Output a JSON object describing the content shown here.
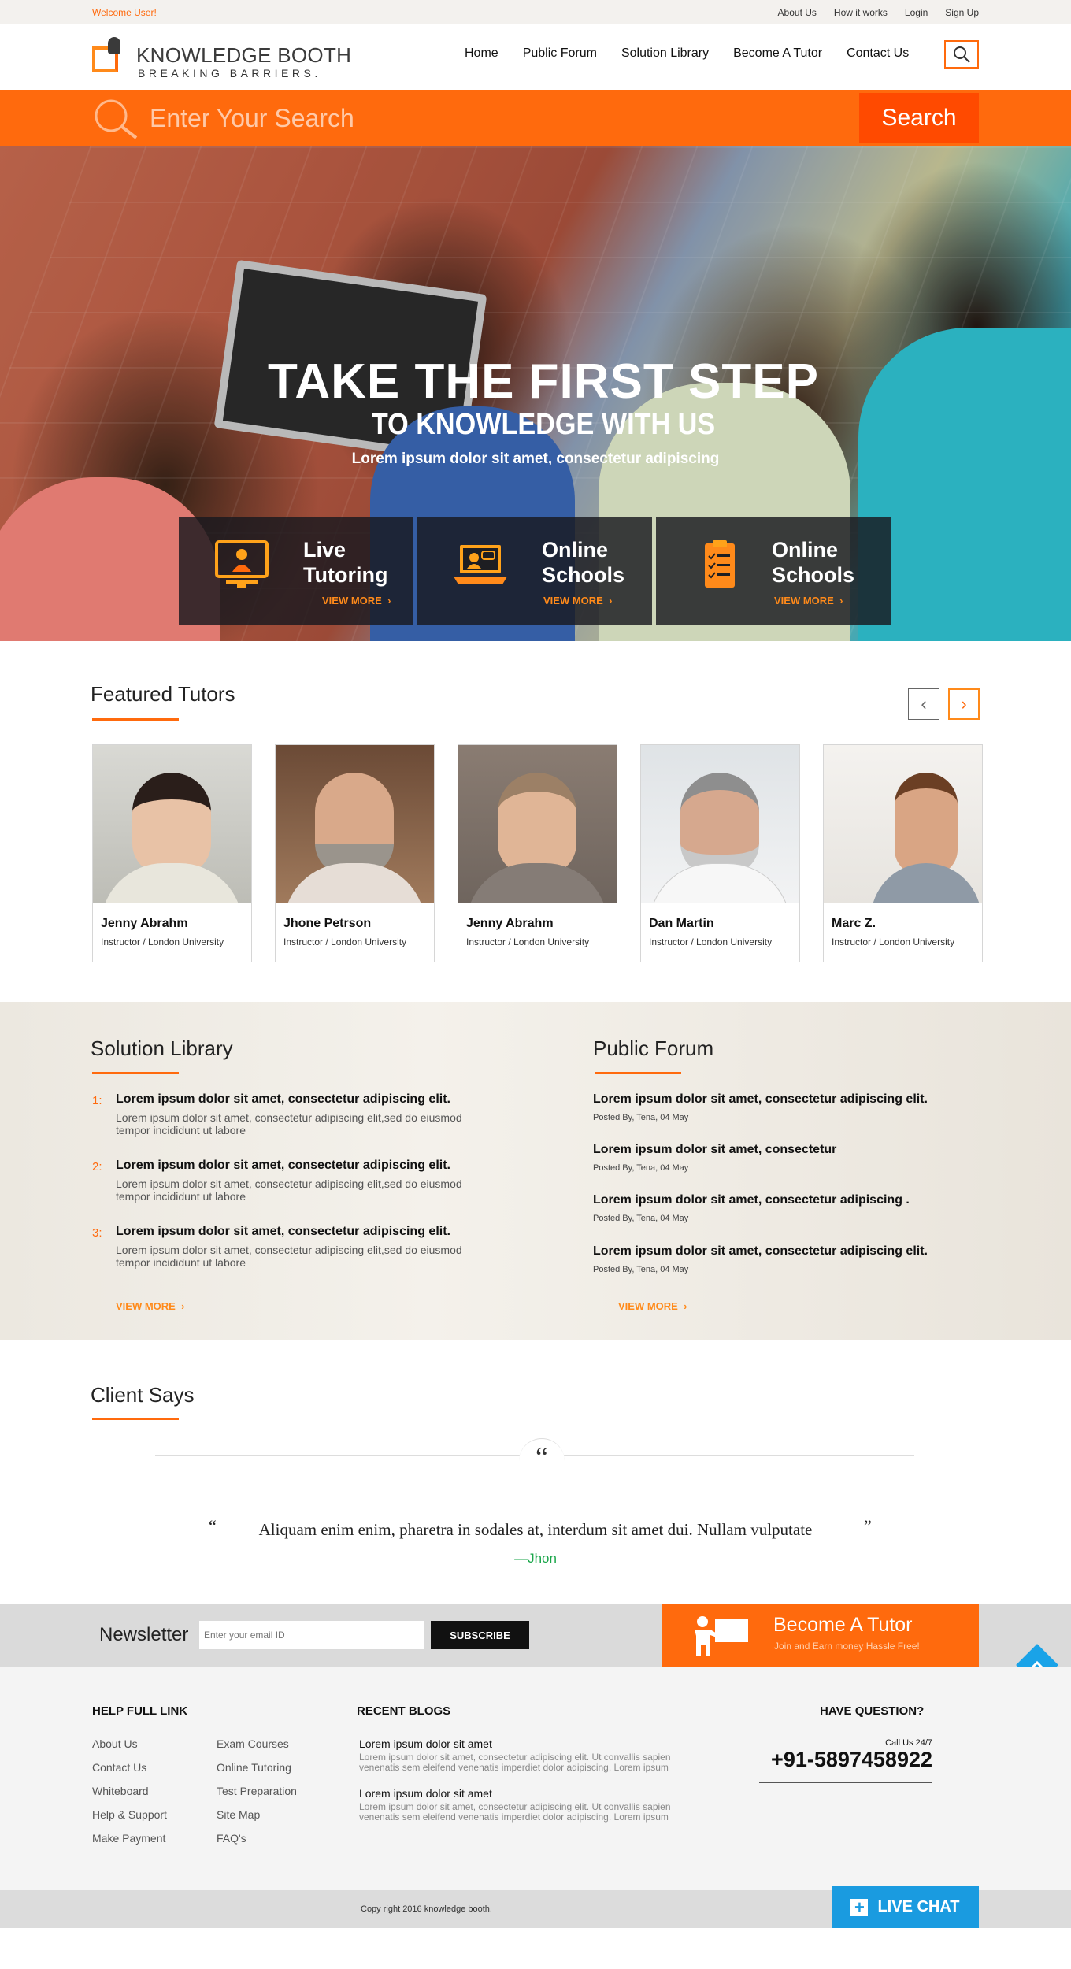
{
  "topbar": {
    "welcome": "Welcome User!",
    "links": [
      "About Us",
      "How it works",
      "Login",
      "Sign Up"
    ]
  },
  "header": {
    "logo_title": "KNOWLEDGE BOOTH",
    "logo_tagline": "BREAKING BARRIERS.",
    "nav": [
      "Home",
      "Public Forum",
      "Solution Library",
      "Become A Tutor",
      "Contact Us"
    ],
    "search_icon": "search-icon"
  },
  "search": {
    "placeholder": "Enter Your Search",
    "button": "Search"
  },
  "hero": {
    "title": "TAKE THE FIRST STEP",
    "subtitle": "TO KNOWLEDGE WITH US",
    "tagline": "Lorem ipsum dolor sit amet, consectetur adipiscing",
    "features": [
      {
        "line1": "Live",
        "line2": "Tutoring",
        "more": "VIEW MORE",
        "icon": "tutor-monitor-icon"
      },
      {
        "line1": "Online",
        "line2": "Schools",
        "more": "VIEW MORE",
        "icon": "laptop-chat-icon"
      },
      {
        "line1": "Online",
        "line2": "Schools",
        "more": "VIEW MORE",
        "icon": "clipboard-checklist-icon"
      }
    ]
  },
  "featured_tutors": {
    "title": "Featured Tutors",
    "tutors": [
      {
        "name": "Jenny Abrahm",
        "role": "Instructor / London University"
      },
      {
        "name": "Jhone Petrson",
        "role": "Instructor / London University"
      },
      {
        "name": "Jenny Abrahm",
        "role": "Instructor / London University"
      },
      {
        "name": "Dan Martin",
        "role": "Instructor / London University"
      },
      {
        "name": "Marc Z.",
        "role": "Instructor / London University"
      }
    ]
  },
  "solution_library": {
    "title": "Solution Library",
    "items": [
      {
        "num": "1:",
        "head": "Lorem ipsum dolor sit amet, consectetur adipiscing elit.",
        "text": "Lorem ipsum dolor sit amet, consectetur adipiscing elit,sed do eiusmod tempor incididunt ut labore"
      },
      {
        "num": "2:",
        "head": "Lorem ipsum dolor sit amet, consectetur adipiscing elit.",
        "text": "Lorem ipsum dolor sit amet, consectetur adipiscing elit,sed do eiusmod tempor incididunt ut labore"
      },
      {
        "num": "3:",
        "head": "Lorem ipsum dolor sit amet, consectetur adipiscing elit.",
        "text": "Lorem ipsum dolor sit amet, consectetur adipiscing elit,sed do eiusmod tempor incididunt ut labore"
      }
    ],
    "more": "VIEW MORE"
  },
  "public_forum": {
    "title": "Public Forum",
    "posts": [
      {
        "head": "Lorem ipsum dolor sit amet, consectetur adipiscing elit.",
        "meta": "Posted By, Tena, 04 May"
      },
      {
        "head": "Lorem ipsum dolor sit amet, consectetur",
        "meta": "Posted By, Tena, 04 May"
      },
      {
        "head": "Lorem ipsum dolor sit amet, consectetur adipiscing .",
        "meta": "Posted By, Tena, 04 May"
      },
      {
        "head": "Lorem ipsum dolor sit amet, consectetur adipiscing elit.",
        "meta": "Posted By, Tena, 04 May"
      }
    ],
    "more": "VIEW MORE"
  },
  "client_says": {
    "title": "Client Says",
    "quote_mark": "“",
    "quote": "Aliquam enim enim, pharetra in sodales at, interdum sit amet dui. Nullam vulputate",
    "open": "“",
    "close": "”",
    "author": "—Jhon"
  },
  "newsletter": {
    "label": "Newsletter",
    "placeholder": "Enter your email ID",
    "button": "SUBSCRIBE"
  },
  "become_tutor": {
    "title": "Become A Tutor",
    "subtitle": "Join and Earn money Hassle Free!"
  },
  "footer": {
    "help_title": "HELP FULL LINK",
    "links_col1": [
      "About Us",
      "Contact Us",
      "Whiteboard",
      "Help & Support",
      "Make Payment"
    ],
    "links_col2": [
      "Exam Courses",
      "Online Tutoring",
      "Test Preparation",
      "Site Map",
      "FAQ's"
    ],
    "blogs_title": "RECENT BLOGS",
    "blogs": [
      {
        "title": "Lorem ipsum dolor sit amet",
        "text": "Lorem ipsum dolor sit amet, consectetur adipiscing elit. Ut convallis sapien venenatis sem eleifend venenatis imperdiet dolor adipiscing. Lorem ipsum"
      },
      {
        "title": "Lorem ipsum dolor sit amet",
        "text": "Lorem ipsum dolor sit amet, consectetur adipiscing elit. Ut convallis sapien venenatis sem eleifend venenatis imperdiet dolor adipiscing. Lorem ipsum"
      }
    ],
    "question_title": "HAVE QUESTION?",
    "call_label": "Call Us 24/7",
    "phone": "+91-5897458922",
    "copyright": "Copy right 2016  knowledge booth."
  },
  "live_chat": {
    "label": "LIVE CHAT"
  },
  "colors": {
    "accent": "#ff6a0d",
    "accent_dark": "#ff4a00",
    "chat_blue": "#1a9be0",
    "author_green": "#1aa64a"
  }
}
